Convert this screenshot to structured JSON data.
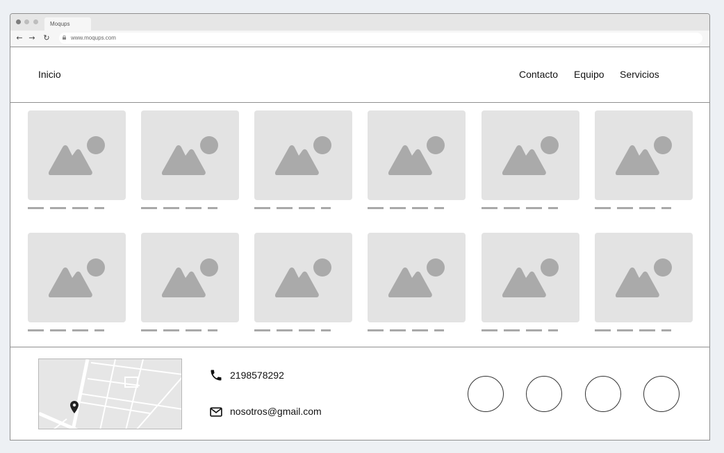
{
  "browser": {
    "tab_title": "Moqups",
    "url": "www.moqups.com",
    "window_dots": [
      "#7d7d7d",
      "#bdbdbd",
      "#bdbdbd"
    ]
  },
  "nav": {
    "home": "Inicio",
    "links": [
      "Contacto",
      "Equipo",
      "Servicios"
    ]
  },
  "gallery": {
    "rows": 2,
    "columns": 6,
    "placeholder_icon": "image-placeholder-icon"
  },
  "footer": {
    "map_icon": "map-placeholder",
    "phone_icon": "phone-icon",
    "phone": "2198578292",
    "email_icon": "mail-icon",
    "email": "nosotros@gmail.com",
    "social_count": 4
  },
  "colors": {
    "page_bg": "#edf0f4",
    "placeholder_bg": "#e3e3e3",
    "placeholder_fg": "#aaaaaa",
    "border": "#8f8f8f"
  }
}
